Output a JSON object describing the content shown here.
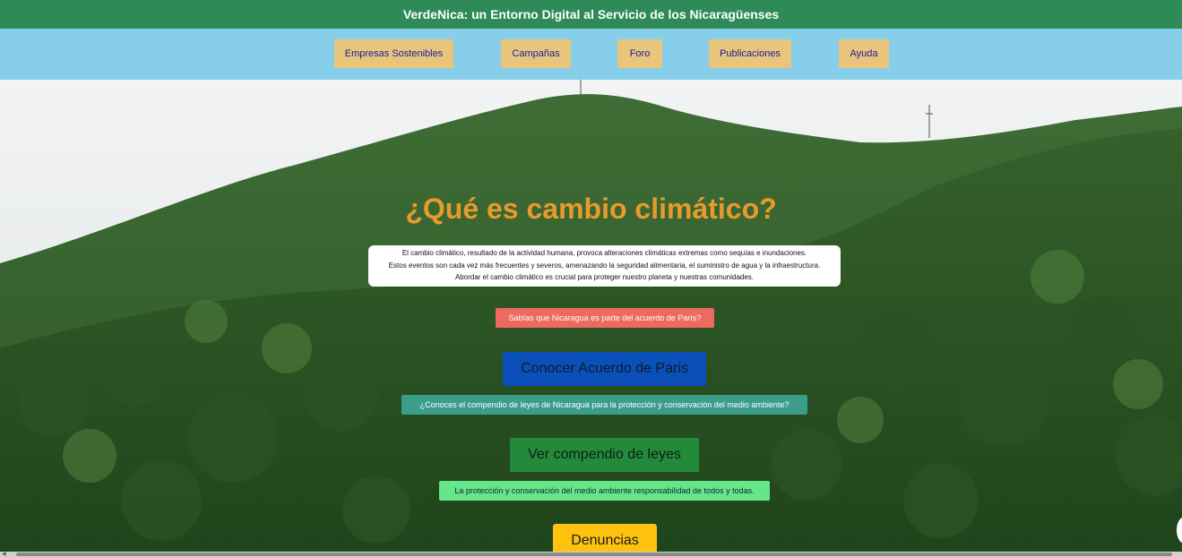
{
  "header": {
    "title": "VerdeNica: un Entorno Digital al Servicio de los Nicaragüenses"
  },
  "nav": {
    "items": [
      {
        "label": "Empresas Sostenibles"
      },
      {
        "label": "Campañas"
      },
      {
        "label": "Foro"
      },
      {
        "label": "Publicaciones"
      },
      {
        "label": "Ayuda"
      }
    ]
  },
  "hero": {
    "title": "¿Qué es cambio climático?",
    "intro_lines": [
      "El cambio climático, resultado de la actividad humana, provoca alteraciones climáticas extremas como sequías e inundaciones.",
      "Estos eventos son cada vez más frecuentes y severos, amenazando la seguridad alimentaria, el suministro de agua y la infraestructura.",
      "Abordar el cambio climático es crucial para proteger nuestro planeta y nuestras comunidades."
    ],
    "paris_question": "Sabías que Nicaragua es parte del acuerdo de París?",
    "paris_button": "Conocer Acuerdo de Paris",
    "laws_question": "¿Conoces el compendio de leyes de Nicaragua para la protección y conservación del medio ambiente?",
    "laws_button": "Ver compendio de leyes",
    "responsibility_note": "La protección y conservación del medio ambiente responsabilidad de todos y todas.",
    "report_button": "Denuncias"
  },
  "colors": {
    "header_bg": "#2e8b57",
    "nav_bg": "#87ceeb",
    "nav_button_bg": "#e8c57a",
    "title_color": "#e89a2c",
    "paris_button_bg": "#0b50b8",
    "laws_button_bg": "#23893b",
    "report_button_bg": "#ffc20e"
  }
}
